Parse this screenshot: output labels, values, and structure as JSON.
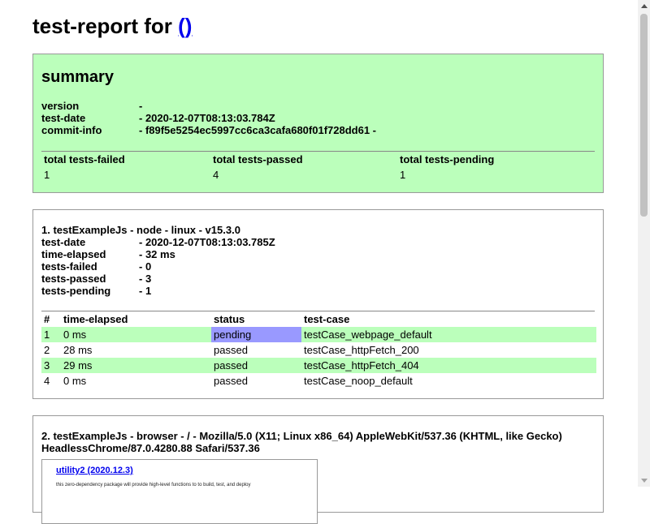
{
  "header": {
    "title_text": "test-report for ",
    "link_text": "()"
  },
  "summary": {
    "heading": "summary",
    "fields": [
      {
        "key": "version",
        "value": "-"
      },
      {
        "key": "test-date",
        "value": "- 2020-12-07T08:13:03.784Z"
      },
      {
        "key": "commit-info",
        "value": "- f89f5e5254ec5997cc6ca3cafa680f01f728dd61 -"
      }
    ],
    "totals_headers": [
      "total tests-failed",
      "total tests-passed",
      "total tests-pending"
    ],
    "totals_values": [
      "1",
      "4",
      "1"
    ]
  },
  "test1": {
    "title": "1. testExampleJs - node - linux - v15.3.0",
    "fields": [
      {
        "key": "test-date",
        "value": "- 2020-12-07T08:13:03.785Z"
      },
      {
        "key": "time-elapsed",
        "value": "- 32 ms"
      },
      {
        "key": "tests-failed",
        "value": "- 0"
      },
      {
        "key": "tests-passed",
        "value": "- 3"
      },
      {
        "key": "tests-pending",
        "value": "- 1"
      }
    ],
    "table_headers": [
      "#",
      "time-elapsed",
      "status",
      "test-case"
    ],
    "rows": [
      {
        "num": "1",
        "time": "0 ms",
        "status": "pending",
        "case": "testCase_webpage_default"
      },
      {
        "num": "2",
        "time": "28 ms",
        "status": "passed",
        "case": "testCase_httpFetch_200"
      },
      {
        "num": "3",
        "time": "29 ms",
        "status": "passed",
        "case": "testCase_httpFetch_404"
      },
      {
        "num": "4",
        "time": "0 ms",
        "status": "passed",
        "case": "testCase_noop_default"
      }
    ]
  },
  "test2": {
    "title": "2. testExampleJs - browser - / - Mozilla/5.0 (X11; Linux x86_64) AppleWebKit/537.36 (KHTML, like Gecko) HeadlessChrome/87.0.4280.88 Safari/537.36",
    "preview_link": "utility2 (2020.12.3)",
    "preview_desc": "this zero-dependency package will provide high-level functions to to build, test, and deploy"
  },
  "colors": {
    "pass_bg": "#bbffbb",
    "pending_bg": "#9999ff",
    "link": "#0000ee"
  }
}
